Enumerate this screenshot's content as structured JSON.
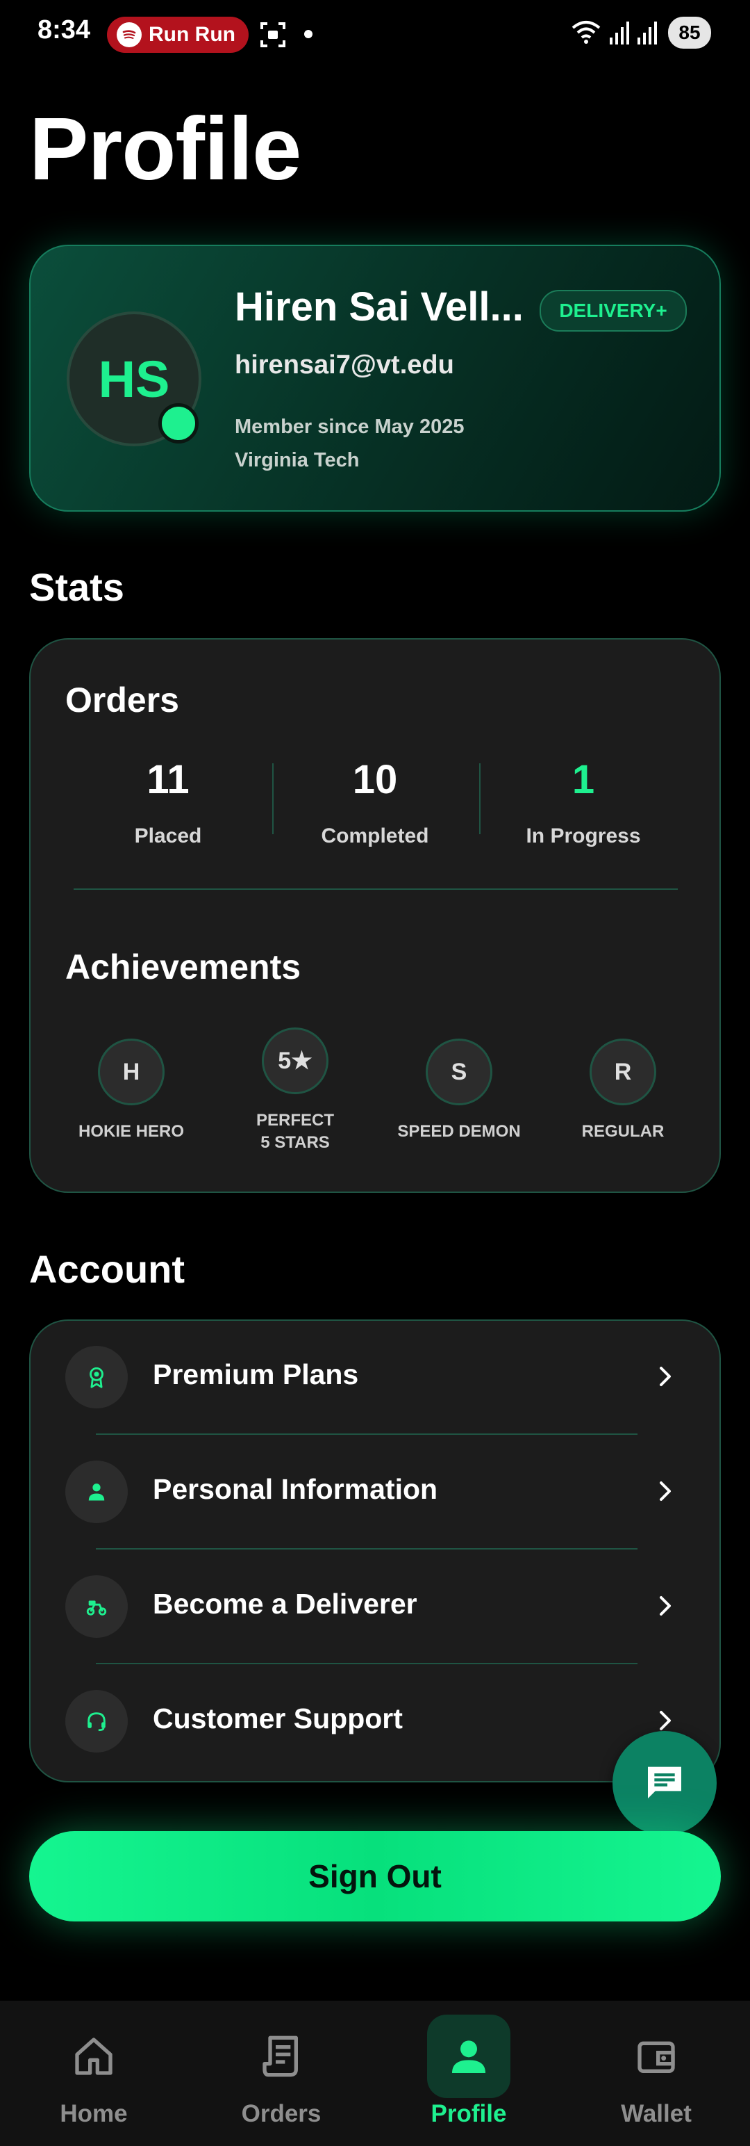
{
  "status_bar": {
    "time": "8:34",
    "app_pill": "Run Run",
    "battery": "85"
  },
  "page_title": "Profile",
  "profile": {
    "initials": "HS",
    "name": "Hiren Sai Vell...",
    "badge": "DELIVERY+",
    "email": "hirensai7@vt.edu",
    "member_since": "Member since May 2025",
    "school": "Virginia Tech"
  },
  "stats": {
    "section_title": "Stats",
    "orders_heading": "Orders",
    "orders": [
      {
        "value": "11",
        "label": "Placed"
      },
      {
        "value": "10",
        "label": "Completed"
      },
      {
        "value": "1",
        "label": "In Progress"
      }
    ],
    "achievements_heading": "Achievements",
    "achievements": [
      {
        "icon": "H",
        "label": "HOKIE HERO"
      },
      {
        "icon": "5★",
        "label": "PERFECT 5 STARS"
      },
      {
        "icon": "S",
        "label": "SPEED DEMON"
      },
      {
        "icon": "R",
        "label": "REGULAR"
      }
    ]
  },
  "account": {
    "section_title": "Account",
    "items": [
      {
        "label": "Premium Plans",
        "icon": "award-icon"
      },
      {
        "label": "Personal Information",
        "icon": "person-icon"
      },
      {
        "label": "Become a Deliverer",
        "icon": "scooter-icon"
      },
      {
        "label": "Customer Support",
        "icon": "headset-icon"
      }
    ]
  },
  "sign_out": "Sign Out",
  "nav": {
    "items": [
      {
        "label": "Home",
        "icon": "home-icon"
      },
      {
        "label": "Orders",
        "icon": "receipt-icon"
      },
      {
        "label": "Profile",
        "icon": "person-icon",
        "active": true
      },
      {
        "label": "Wallet",
        "icon": "wallet-icon"
      }
    ]
  },
  "colors": {
    "accent": "#1ef08f",
    "card": "#1c1c1c",
    "border": "#1f5443",
    "background": "#000000"
  }
}
